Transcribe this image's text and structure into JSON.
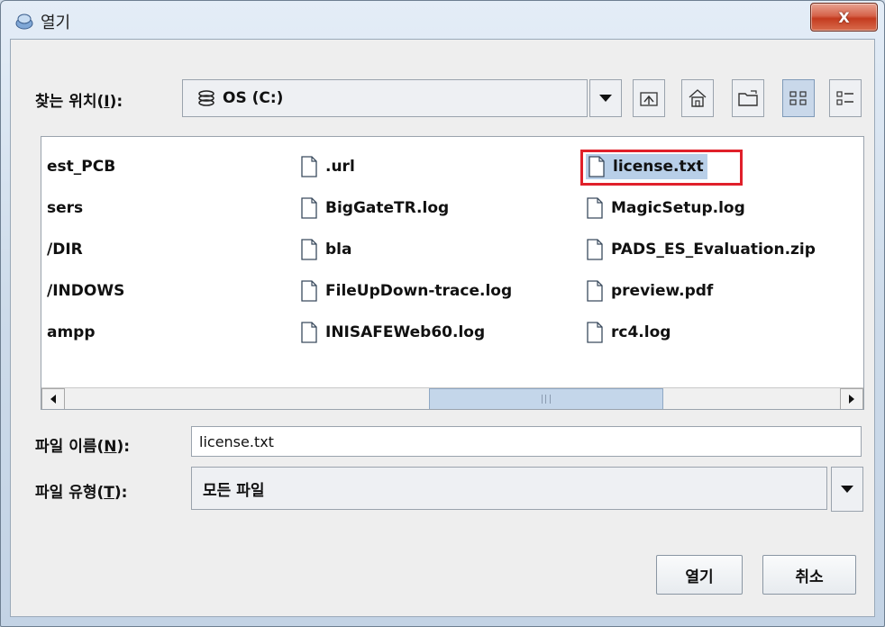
{
  "window": {
    "title": "열기",
    "close_label": "X"
  },
  "look_in": {
    "label": "찾는 위치",
    "mnemonic": "I",
    "value": "OS (C:)"
  },
  "toolbar": [
    {
      "name": "up-folder-button",
      "icon": "up-one-level-icon"
    },
    {
      "name": "home-button",
      "icon": "home-icon"
    },
    {
      "name": "new-folder-button",
      "icon": "new-folder-icon"
    },
    {
      "name": "list-view-button",
      "icon": "list-view-icon",
      "active": true
    },
    {
      "name": "details-view-button",
      "icon": "details-view-icon"
    }
  ],
  "files": {
    "col1": [
      "est_PCB",
      "sers",
      "/DIR",
      "/INDOWS",
      "ampp"
    ],
    "col2": [
      ".url",
      "BigGateTR.log",
      "bla",
      "FileUpDown-trace.log",
      "INISAFEWeb60.log"
    ],
    "col3": [
      "license.txt",
      "MagicSetup.log",
      "PADS_ES_Evaluation.zip",
      "preview.pdf",
      "rc4.log"
    ],
    "selected": "license.txt"
  },
  "filename": {
    "label": "파일 이름",
    "mnemonic": "N",
    "value": "license.txt"
  },
  "filetype": {
    "label": "파일 유형",
    "mnemonic": "T",
    "value": "모든 파일"
  },
  "buttons": {
    "open": "열기",
    "cancel": "취소"
  },
  "colors": {
    "selection_highlight": "#e0202a",
    "selection_bg": "#b8cfe8"
  }
}
